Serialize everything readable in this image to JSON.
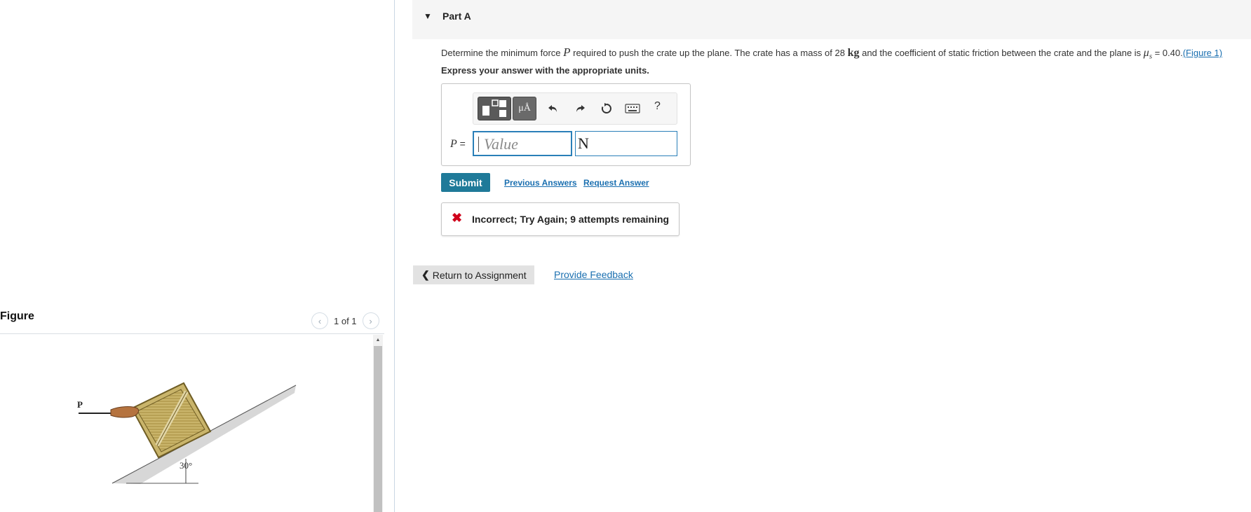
{
  "part": {
    "title": "Part A",
    "caret_icon": "caret-down-icon"
  },
  "question": {
    "text_before_var": "Determine the minimum force ",
    "var_p": "P",
    "text_after_var": " required to push the crate up the plane. The crate has a mass of 28 ",
    "mass_unit": "kg",
    "text_after_mass": " and the coefficient of static friction between the crate and the plane is ",
    "mu_symbol": "μ",
    "mu_subscript": "s",
    "mu_value_text": " = 0.40.",
    "figure_link": "(Figure 1)",
    "instructions": "Express your answer with the appropriate units."
  },
  "answer": {
    "label_var": "P",
    "label_eq": " =",
    "value_placeholder": "Value",
    "value": "",
    "unit": "N",
    "toolbar": {
      "units_label": "μÅ",
      "help_label": "?",
      "icons": [
        "templates-icon",
        "units-icon",
        "undo-icon",
        "redo-icon",
        "reset-icon",
        "keyboard-icon",
        "help-icon"
      ]
    }
  },
  "actions": {
    "submit": "Submit",
    "previous_answers": "Previous Answers",
    "request_answer": "Request Answer"
  },
  "feedback": {
    "icon": "x-icon",
    "message": "Incorrect; Try Again; 9 attempts remaining",
    "color": "#d0021b"
  },
  "footer": {
    "return_label": "Return to Assignment",
    "provide_feedback": "Provide Feedback"
  },
  "figure": {
    "title": "Figure",
    "pager": "1 of 1",
    "force_label": "P",
    "angle_label": "30°"
  },
  "colors": {
    "accent": "#1f7a99",
    "link": "#1a6fb0",
    "input_border": "#2a7fb8"
  }
}
